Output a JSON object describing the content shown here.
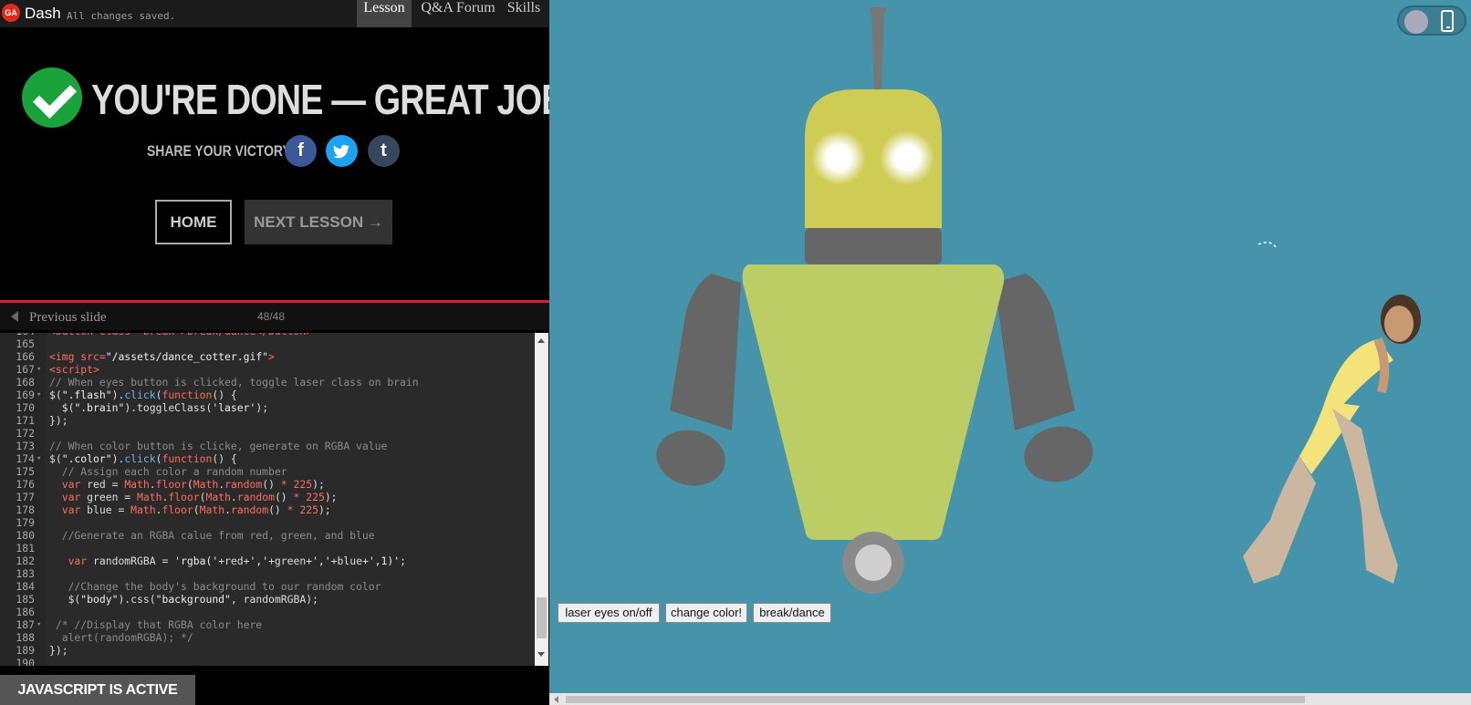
{
  "topbar": {
    "logo_text": "GA",
    "app_name": "Dash",
    "save_status": "All changes saved.",
    "tabs": [
      {
        "label": "Lesson",
        "active": true
      },
      {
        "label": "Q&A Forum",
        "active": false
      },
      {
        "label": "Skills",
        "active": false
      }
    ]
  },
  "completion": {
    "title": "YOU'RE DONE — GREAT JOB!",
    "share_label": "SHARE YOUR VICTORY:",
    "share_icons": {
      "facebook": "f",
      "twitter": "t",
      "tumblr": "t"
    },
    "home_label": "HOME",
    "next_label": "NEXT LESSON →"
  },
  "slide_nav": {
    "prev_label": "Previous slide",
    "count": "48/48"
  },
  "editor": {
    "lines": [
      {
        "num": "164",
        "fold": "",
        "tokens": [
          [
            "c-tag",
            "<button class=\"break\">break/dance</button>"
          ]
        ]
      },
      {
        "num": "165",
        "fold": "",
        "tokens": []
      },
      {
        "num": "166",
        "fold": "",
        "tokens": [
          [
            "c-tag",
            "<img "
          ],
          [
            "c-tag",
            "src="
          ],
          [
            "c-str",
            "\"/assets/dance_cotter.gif\""
          ],
          [
            "c-tag",
            ">"
          ]
        ]
      },
      {
        "num": "167",
        "fold": "▾",
        "tokens": [
          [
            "c-tag",
            "<script>"
          ]
        ]
      },
      {
        "num": "168",
        "fold": "",
        "tokens": [
          [
            "c-com",
            "// When eyes button is clicked, toggle laser class on brain"
          ]
        ]
      },
      {
        "num": "169",
        "fold": "▾",
        "tokens": [
          [
            "c-plain",
            "$("
          ],
          [
            "c-str",
            "\".flash\""
          ],
          [
            "c-plain",
            ")."
          ],
          [
            "c-fn",
            "click"
          ],
          [
            "c-plain",
            "("
          ],
          [
            "c-kw",
            "function"
          ],
          [
            "c-plain",
            "() {"
          ]
        ]
      },
      {
        "num": "170",
        "fold": "",
        "tokens": [
          [
            "c-plain",
            "  $("
          ],
          [
            "c-str",
            "\".brain\""
          ],
          [
            "c-plain",
            ").toggleClass("
          ],
          [
            "c-str",
            "'laser'"
          ],
          [
            "c-plain",
            ");"
          ]
        ]
      },
      {
        "num": "171",
        "fold": "",
        "tokens": [
          [
            "c-plain",
            "});"
          ]
        ]
      },
      {
        "num": "172",
        "fold": "",
        "tokens": []
      },
      {
        "num": "173",
        "fold": "",
        "tokens": [
          [
            "c-com",
            "// When color button is clicke, generate on RGBA value"
          ]
        ]
      },
      {
        "num": "174",
        "fold": "▾",
        "tokens": [
          [
            "c-plain",
            "$("
          ],
          [
            "c-str",
            "\".color\""
          ],
          [
            "c-plain",
            ")."
          ],
          [
            "c-fn",
            "click"
          ],
          [
            "c-plain",
            "("
          ],
          [
            "c-kw",
            "function"
          ],
          [
            "c-plain",
            "() {"
          ]
        ]
      },
      {
        "num": "175",
        "fold": "",
        "tokens": [
          [
            "c-com",
            "  // Assign each color a random number"
          ]
        ]
      },
      {
        "num": "176",
        "fold": "",
        "tokens": [
          [
            "c-plain",
            "  "
          ],
          [
            "c-kw",
            "var"
          ],
          [
            "c-plain",
            " red = "
          ],
          [
            "c-kw",
            "Math"
          ],
          [
            "c-plain",
            "."
          ],
          [
            "c-kw",
            "floor"
          ],
          [
            "c-plain",
            "("
          ],
          [
            "c-kw",
            "Math"
          ],
          [
            "c-plain",
            "."
          ],
          [
            "c-kw",
            "random"
          ],
          [
            "c-plain",
            "() "
          ],
          [
            "c-kw",
            "*"
          ],
          [
            "c-plain",
            " "
          ],
          [
            "c-kw",
            "225"
          ],
          [
            "c-plain",
            ");"
          ]
        ]
      },
      {
        "num": "177",
        "fold": "",
        "tokens": [
          [
            "c-plain",
            "  "
          ],
          [
            "c-kw",
            "var"
          ],
          [
            "c-plain",
            " green = "
          ],
          [
            "c-kw",
            "Math"
          ],
          [
            "c-plain",
            "."
          ],
          [
            "c-kw",
            "floor"
          ],
          [
            "c-plain",
            "("
          ],
          [
            "c-kw",
            "Math"
          ],
          [
            "c-plain",
            "."
          ],
          [
            "c-kw",
            "random"
          ],
          [
            "c-plain",
            "() "
          ],
          [
            "c-kw",
            "*"
          ],
          [
            "c-plain",
            " "
          ],
          [
            "c-kw",
            "225"
          ],
          [
            "c-plain",
            ");"
          ]
        ]
      },
      {
        "num": "178",
        "fold": "",
        "tokens": [
          [
            "c-plain",
            "  "
          ],
          [
            "c-kw",
            "var"
          ],
          [
            "c-plain",
            " blue = "
          ],
          [
            "c-kw",
            "Math"
          ],
          [
            "c-plain",
            "."
          ],
          [
            "c-kw",
            "floor"
          ],
          [
            "c-plain",
            "("
          ],
          [
            "c-kw",
            "Math"
          ],
          [
            "c-plain",
            "."
          ],
          [
            "c-kw",
            "random"
          ],
          [
            "c-plain",
            "() "
          ],
          [
            "c-kw",
            "*"
          ],
          [
            "c-plain",
            " "
          ],
          [
            "c-kw",
            "225"
          ],
          [
            "c-plain",
            ");"
          ]
        ]
      },
      {
        "num": "179",
        "fold": "",
        "tokens": []
      },
      {
        "num": "180",
        "fold": "",
        "tokens": [
          [
            "c-com",
            "  //Generate an RGBA calue from red, green, and blue"
          ]
        ]
      },
      {
        "num": "181",
        "fold": "",
        "tokens": []
      },
      {
        "num": "182",
        "fold": "",
        "tokens": [
          [
            "c-plain",
            "   "
          ],
          [
            "c-kw",
            "var"
          ],
          [
            "c-plain",
            " randomRGBA = "
          ],
          [
            "c-str",
            "'rgba('"
          ],
          [
            "c-plain",
            "+red+"
          ],
          [
            "c-str",
            "','"
          ],
          [
            "c-plain",
            "+green+"
          ],
          [
            "c-str",
            "','"
          ],
          [
            "c-plain",
            "+blue+"
          ],
          [
            "c-str",
            "',1)'"
          ],
          [
            "c-plain",
            ";"
          ]
        ]
      },
      {
        "num": "183",
        "fold": "",
        "tokens": []
      },
      {
        "num": "184",
        "fold": "",
        "tokens": [
          [
            "c-com",
            "   //Change the body's background to our random color"
          ]
        ]
      },
      {
        "num": "185",
        "fold": "",
        "tokens": [
          [
            "c-plain",
            "   $("
          ],
          [
            "c-str",
            "\"body\""
          ],
          [
            "c-plain",
            ").css("
          ],
          [
            "c-str",
            "\"background\""
          ],
          [
            "c-plain",
            ", randomRGBA);"
          ]
        ]
      },
      {
        "num": "186",
        "fold": "",
        "tokens": []
      },
      {
        "num": "187",
        "fold": "▾",
        "tokens": [
          [
            "c-com",
            " /* //Display that RGBA color here"
          ]
        ]
      },
      {
        "num": "188",
        "fold": "",
        "tokens": [
          [
            "c-com",
            "  alert(randomRGBA); */"
          ]
        ]
      },
      {
        "num": "189",
        "fold": "",
        "tokens": [
          [
            "c-plain",
            "});"
          ]
        ]
      },
      {
        "num": "190",
        "fold": "",
        "tokens": []
      }
    ]
  },
  "status": {
    "js_active": "JAVASCRIPT IS ACTIVE"
  },
  "preview": {
    "buttons": {
      "laser": "laser eyes on/off",
      "color": "change color!",
      "break": "break/dance"
    },
    "colors": {
      "background": "#4694ab",
      "head": "#cfcc55",
      "body": "#bccd66",
      "limbs": "#666666",
      "antenna": "#777777"
    },
    "dancer_image": "dance_cotter.gif",
    "device_toggle_icon": "mobile-phone-icon"
  }
}
